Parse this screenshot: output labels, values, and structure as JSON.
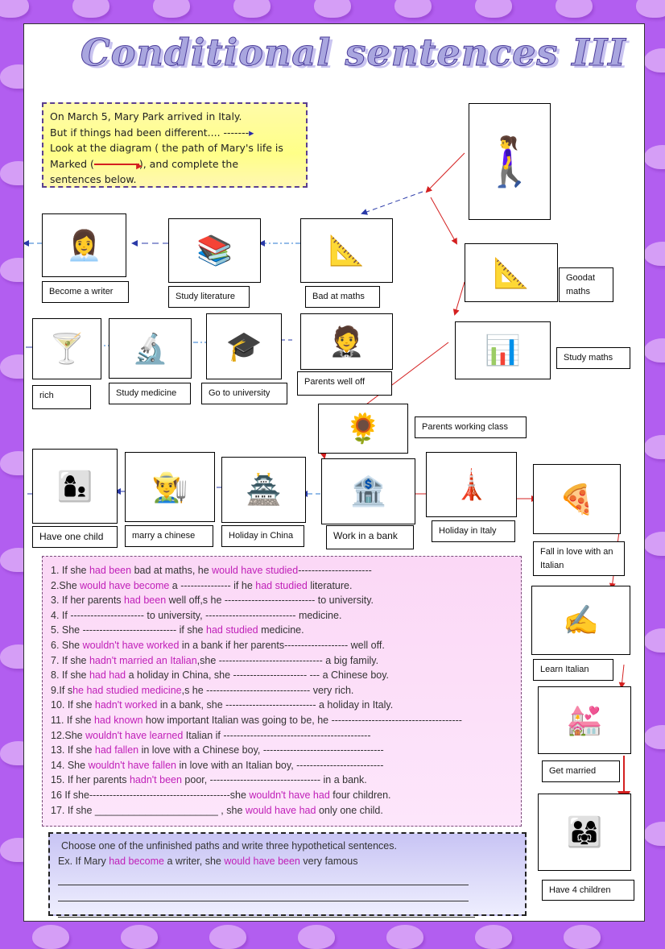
{
  "title": "Conditional sentences III",
  "intro": {
    "lines": [
      "On March 5, Mary Park arrived in Italy.",
      "But if things had been different.... -------",
      "Look at the diagram ( the path of Mary's life is",
      "Marked (",
      "), and complete the",
      "sentences below."
    ]
  },
  "diagram": {
    "start": {
      "icon": "walking-woman",
      "glyph": "🚶‍♀️"
    },
    "nodes": [
      {
        "id": "good-at-maths",
        "label": "Goodat maths",
        "glyph": "📐"
      },
      {
        "id": "study-maths",
        "label": "Study maths",
        "glyph": "📊"
      },
      {
        "id": "bad-at-maths",
        "label": "Bad at maths",
        "glyph": "📐"
      },
      {
        "id": "study-literature",
        "label": "Study literature",
        "glyph": "📚"
      },
      {
        "id": "become-writer",
        "label": "Become a writer",
        "glyph": "👩‍💼"
      },
      {
        "id": "parents-well-off",
        "label": "Parents well off",
        "glyph": "🤵"
      },
      {
        "id": "go-to-university",
        "label": "Go to university",
        "glyph": "🎓"
      },
      {
        "id": "study-medicine",
        "label": "Study  medicine",
        "glyph": "🔬"
      },
      {
        "id": "rich",
        "label": "rich",
        "glyph": "🍸"
      },
      {
        "id": "parents-working-class",
        "label": "Parents working class",
        "glyph": "🌻"
      },
      {
        "id": "work-in-bank",
        "label": "Work in a bank",
        "glyph": "🏦"
      },
      {
        "id": "holiday-italy",
        "label": "Holiday in Italy",
        "glyph": "🗼"
      },
      {
        "id": "fall-in-love",
        "label": "Fall in love with an Italian",
        "glyph": "🍕"
      },
      {
        "id": "learn-italian",
        "label": "Learn Italian",
        "glyph": "✍️"
      },
      {
        "id": "get-married",
        "label": "Get married",
        "glyph": "💒"
      },
      {
        "id": "have-4-children",
        "label": "Have 4 children",
        "glyph": "👨‍👩‍👧"
      },
      {
        "id": "holiday-china",
        "label": "Holiday  in China",
        "glyph": "🏯"
      },
      {
        "id": "marry-chinese",
        "label": "marry  a chinese",
        "glyph": "👨‍🌾"
      },
      {
        "id": "have-one-child",
        "label": "Have one child",
        "glyph": "👩‍👦"
      }
    ]
  },
  "sentences": [
    [
      {
        "t": "1. If she "
      },
      {
        "t": "had been",
        "h": 1
      },
      {
        "t": " bad at maths, he "
      },
      {
        "t": "would have studied",
        "h": 1
      },
      {
        "t": "----------------------"
      }
    ],
    [
      {
        "t": "2.She "
      },
      {
        "t": "would have become",
        "h": 1
      },
      {
        "t": " a --------------- if he "
      },
      {
        "t": "had studied",
        "h": 1
      },
      {
        "t": " literature."
      }
    ],
    [
      {
        "t": "3. If her parents "
      },
      {
        "t": "had been",
        "h": 1
      },
      {
        "t": " well off,s he --------------------------- to university."
      }
    ],
    [
      {
        "t": "4. If ---------------------- to university, --------------------------- medicine."
      }
    ],
    [
      {
        "t": "5. She ---------------------------- if she "
      },
      {
        "t": "had studied",
        "h": 1
      },
      {
        "t": " medicine."
      }
    ],
    [
      {
        "t": "6. She "
      },
      {
        "t": "wouldn't have worked",
        "h": 1
      },
      {
        "t": " in a bank if her parents------------------- well off."
      }
    ],
    [
      {
        "t": "7. If she "
      },
      {
        "t": "hadn't married an Italian",
        "h": 1
      },
      {
        "t": ",she ------------------------------- a big family."
      }
    ],
    [
      {
        "t": "8. If she "
      },
      {
        "t": "had had",
        "h": 1
      },
      {
        "t": " a holiday in China, she ---------------------- --- a Chinese boy."
      }
    ],
    [
      {
        "t": "9.If s"
      },
      {
        "t": "he had studied medicine",
        "h": 1
      },
      {
        "t": ",s he ------------------------------- very rich."
      }
    ],
    [
      {
        "t": "10. If she "
      },
      {
        "t": "hadn't worked",
        "h": 1
      },
      {
        "t": " in a bank, she --------------------------- a holiday in Italy."
      }
    ],
    [
      {
        "t": "11. If she "
      },
      {
        "t": "had known",
        "h": 1
      },
      {
        "t": " how important Italian was going to be, he ---------------------------------------"
      }
    ],
    [
      {
        "t": "12.She "
      },
      {
        "t": "wouldn't have learned",
        "h": 1
      },
      {
        "t": " Italian if --------------------------------------------"
      }
    ],
    [
      {
        "t": "13. If she "
      },
      {
        "t": "had fallen",
        "h": 1
      },
      {
        "t": " in love with a Chinese boy, ------------------------------------"
      }
    ],
    [
      {
        "t": "14. She "
      },
      {
        "t": "wouldn't have fallen",
        "h": 1
      },
      {
        "t": " in love with an Italian boy, --------------------------"
      }
    ],
    [
      {
        "t": "15. If her parents "
      },
      {
        "t": "hadn't been",
        "h": 1
      },
      {
        "t": " poor, --------------------------------- in a bank."
      }
    ],
    [
      {
        "t": "16  If she------------------------------------------she "
      },
      {
        "t": "wouldn't have had",
        "h": 1
      },
      {
        "t": " four children."
      }
    ],
    [
      {
        "t": "17. If she ______________________ , she "
      },
      {
        "t": "would have had",
        "h": 1
      },
      {
        "t": " only one child."
      }
    ]
  ],
  "task": {
    "instruction": "Choose one of the unfinished paths and write three hypothetical sentences.",
    "example": [
      {
        "t": "Ex.   If Mary "
      },
      {
        "t": "had become",
        "h": 1
      },
      {
        "t": " a writer, she "
      },
      {
        "t": "would have been",
        "h": 1
      },
      {
        "t": " very famous"
      }
    ],
    "answer_lines": 3
  },
  "colors": {
    "background": "#b25ef0",
    "highlight": "#c020b8",
    "path_arrow": "#d42020",
    "alt_arrow": "#2a3aa8"
  }
}
